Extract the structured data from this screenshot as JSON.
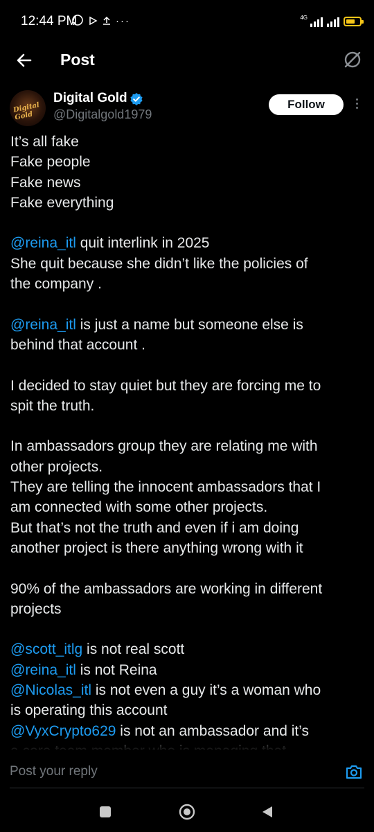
{
  "status_bar": {
    "time": "12:44 PM",
    "network": "4G",
    "battery_level": 0.5,
    "battery_color": "#f5c518"
  },
  "top_bar": {
    "back_icon": "arrow-left-icon",
    "title": "Post",
    "grok_icon": "grok-icon"
  },
  "author": {
    "name": "Digital Gold",
    "handle": "@Digitalgold1979",
    "verified": true,
    "follow_label": "Follow",
    "avatar_text": "Digital Gold"
  },
  "post": {
    "paragraphs": [
      [
        [
          {
            "t": "It’s all fake"
          }
        ],
        [
          {
            "t": "Fake people"
          }
        ],
        [
          {
            "t": "Fake news"
          }
        ],
        [
          {
            "t": "Fake everything"
          }
        ]
      ],
      [
        [
          {
            "t": "@reina_itl",
            "m": true
          },
          {
            "t": " quit interlink in 2025"
          }
        ],
        [
          {
            "t": "She quit because she didn’t like the policies of"
          }
        ],
        [
          {
            "t": "the company ."
          }
        ]
      ],
      [
        [
          {
            "t": "@reina_itl",
            "m": true
          },
          {
            "t": " is just a name but someone else is"
          }
        ],
        [
          {
            "t": "behind that account ."
          }
        ]
      ],
      [
        [
          {
            "t": "I decided to stay quiet but they are forcing me to"
          }
        ],
        [
          {
            "t": "spit the truth."
          }
        ]
      ],
      [
        [
          {
            "t": "In ambassadors group they are relating me with"
          }
        ],
        [
          {
            "t": "other projects."
          }
        ],
        [
          {
            "t": "They are telling the innocent ambassadors that I"
          }
        ],
        [
          {
            "t": "am connected with some other projects."
          }
        ],
        [
          {
            "t": "But that’s not the truth and even if i am doing"
          }
        ],
        [
          {
            "t": "another project is there anything wrong with it"
          }
        ]
      ],
      [
        [
          {
            "t": "90% of the ambassadors are working in different"
          }
        ],
        [
          {
            "t": "projects"
          }
        ]
      ],
      [
        [
          {
            "t": "@scott_itlg",
            "m": true
          },
          {
            "t": " is not real scott"
          }
        ],
        [
          {
            "t": "@reina_itl",
            "m": true
          },
          {
            "t": " is not Reina"
          }
        ],
        [
          {
            "t": "@Nicolas_itl",
            "m": true
          },
          {
            "t": " is not even a guy it’s a woman who"
          }
        ],
        [
          {
            "t": "is operating this account"
          }
        ],
        [
          {
            "t": "@VyxCrypto629",
            "m": true
          },
          {
            "t": " is not an ambassador and it’s"
          }
        ],
        [
          {
            "t": "a core team member who is managing that"
          }
        ]
      ]
    ],
    "mention_color": "#1d9bf0"
  },
  "reply": {
    "placeholder": "Post your reply",
    "camera_icon": "camera-icon"
  },
  "nav_bar": {
    "recents_icon": "square-icon",
    "home_icon": "circle-home-icon",
    "back_icon": "triangle-back-icon"
  }
}
